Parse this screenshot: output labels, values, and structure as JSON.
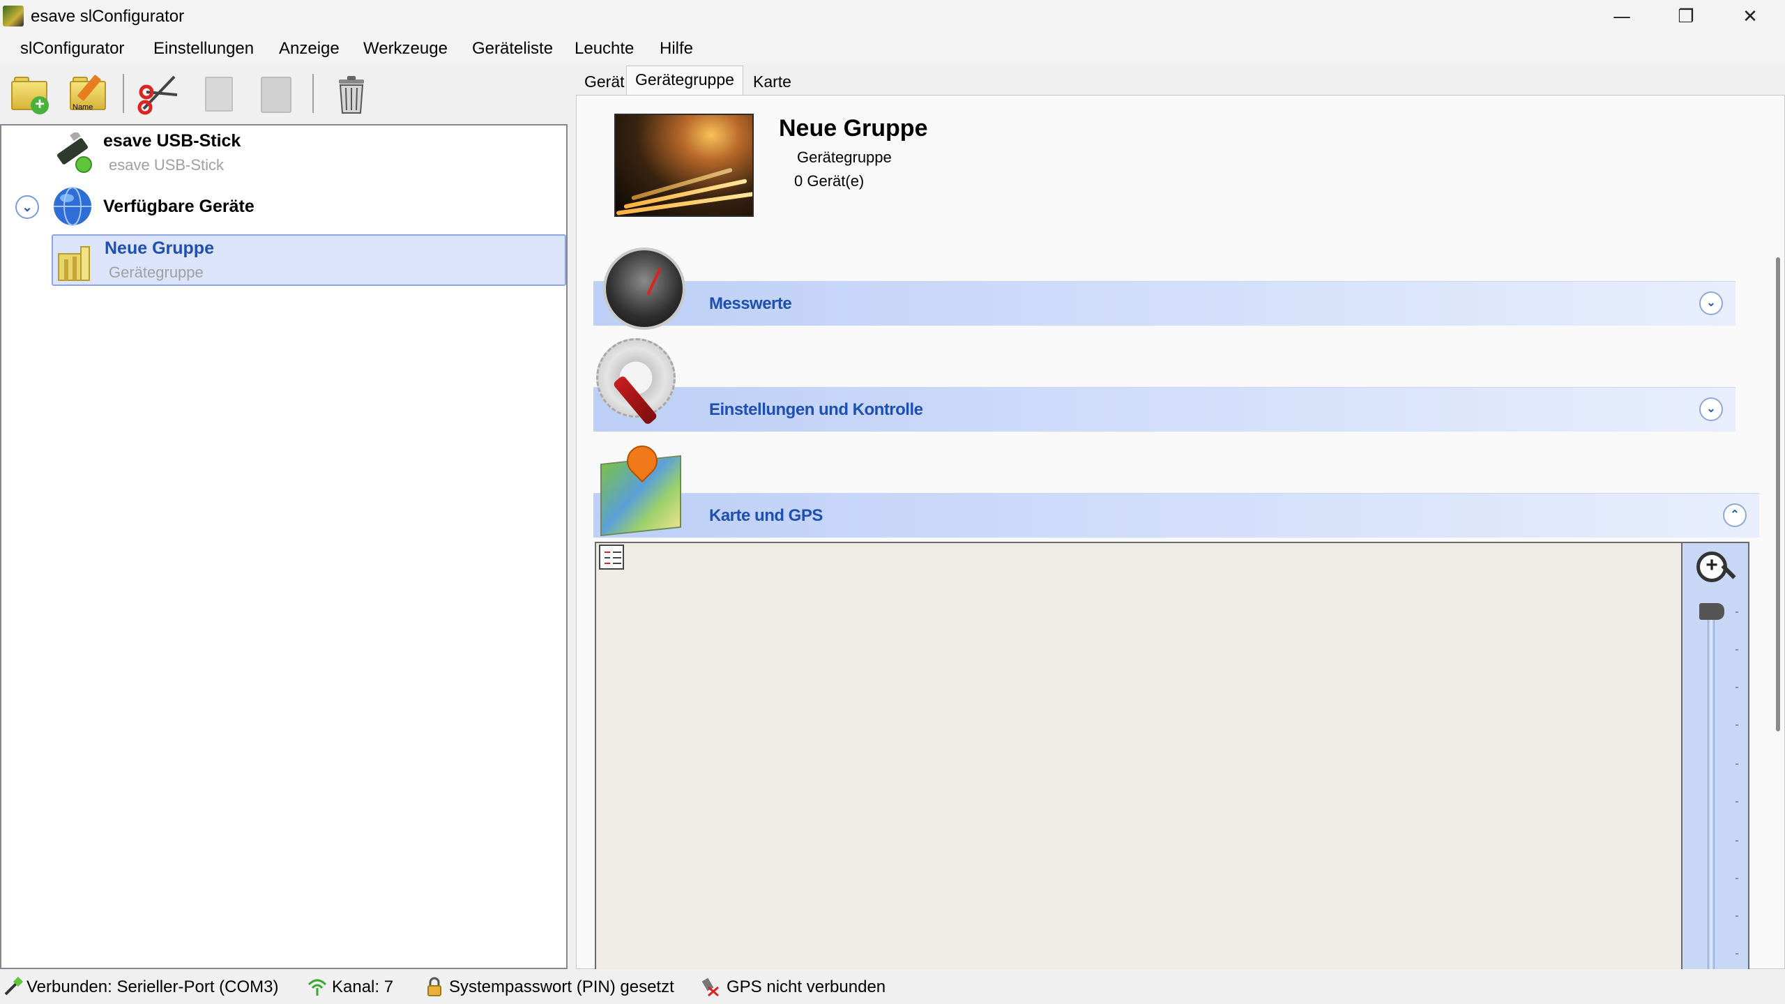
{
  "window": {
    "title": "esave slConfigurator",
    "minimize_glyph": "—",
    "maximize_glyph": "❐",
    "close_glyph": "✕"
  },
  "menu": [
    "slConfigurator",
    "Einstellungen",
    "Anzeige",
    "Werkzeuge",
    "Geräteliste",
    "Leuchte",
    "Hilfe"
  ],
  "toolbar": {
    "rename_tag": "Name"
  },
  "tree": {
    "usb": {
      "title": "esave USB-Stick",
      "subtitle": "esave USB-Stick"
    },
    "available": {
      "title": "Verfügbare Geräte"
    },
    "group": {
      "title": "Neue Gruppe",
      "subtitle": "Gerätegruppe"
    }
  },
  "tabs": [
    "Gerät",
    "Gerätegruppe",
    "Karte"
  ],
  "group": {
    "title": "Neue Gruppe",
    "type": "Gerätegruppe",
    "count": "0 Gerät(e)"
  },
  "sections": {
    "measurements": "Messwerte",
    "settings": "Einstellungen und Kontrolle",
    "map": "Karte und GPS"
  },
  "status": {
    "connection": "Verbunden: Serieller-Port (COM3)",
    "channel": "Kanal: 7",
    "password": "Systempasswort (PIN) gesetzt",
    "gps": "GPS nicht verbunden"
  }
}
